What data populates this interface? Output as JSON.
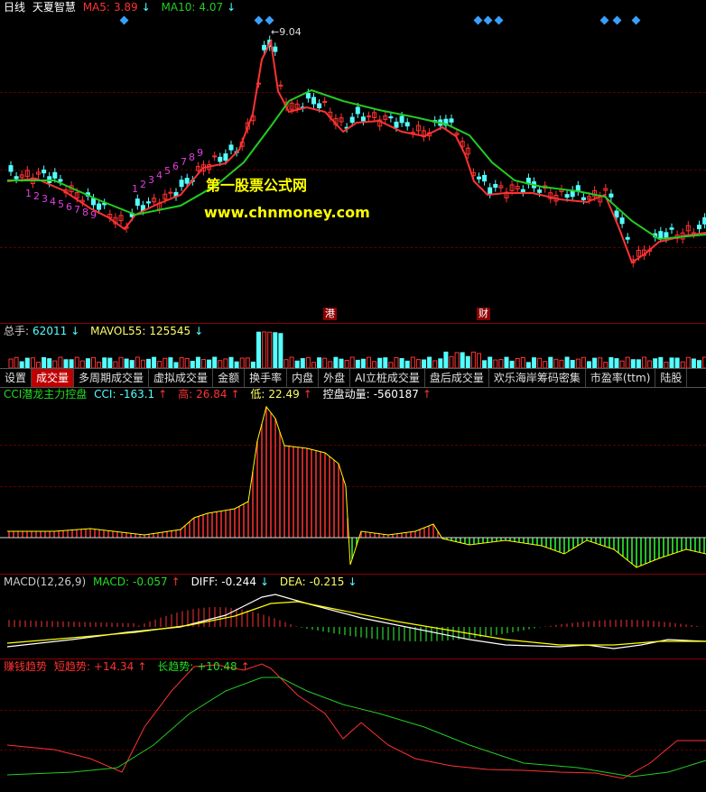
{
  "kline": {
    "period": "日线",
    "name": "天夏智慧",
    "ma5_label": "MA5:",
    "ma5_value": "3.89",
    "ma5_arrow": "↓",
    "ma10_label": "MA10:",
    "ma10_value": "4.07",
    "ma10_arrow": "↓",
    "peak_label": "9.04",
    "markers": [
      "港",
      "财"
    ],
    "watermark_cn": "第一股票公式网",
    "watermark_url": "www.chnmoney.com",
    "count_labels_a": [
      "1",
      "2",
      "3",
      "4",
      "5",
      "6",
      "7",
      "8",
      "9"
    ],
    "count_labels_b": [
      "1",
      "2",
      "3",
      "4",
      "5",
      "6",
      "7",
      "8",
      "9"
    ]
  },
  "volume": {
    "label": "总手:",
    "value": "62011",
    "arrow": "↓",
    "mavol_label": "MAVOL55:",
    "mavol_value": "125545",
    "mavol_arrow": "↓"
  },
  "tabs": [
    "设置",
    "成交量",
    "多周期成交量",
    "虚拟成交量",
    "金额",
    "换手率",
    "内盘",
    "外盘",
    "AI立桩成交量",
    "盘后成交量",
    "欢乐海岸筹码密集",
    "市盈率(ttm)",
    "陆股"
  ],
  "cci": {
    "title": "CCI潜龙主力控盘",
    "cci_label": "CCI:",
    "cci_value": "-163.1",
    "cci_arrow": "↑",
    "high_label": "高:",
    "high_value": "26.84",
    "high_arrow": "↑",
    "low_label": "低:",
    "low_value": "22.49",
    "low_arrow": "↑",
    "ctrl_label": "控盘动量:",
    "ctrl_value": "-560187",
    "ctrl_arrow": "↑"
  },
  "macd": {
    "title": "MACD(12,26,9)",
    "macd_label": "MACD:",
    "macd_value": "-0.057",
    "macd_arrow": "↑",
    "diff_label": "DIFF:",
    "diff_value": "-0.244",
    "diff_arrow": "↓",
    "dea_label": "DEA:",
    "dea_value": "-0.215",
    "dea_arrow": "↓"
  },
  "trend": {
    "title": "赚钱趋势",
    "short_label": "短趋势:",
    "short_value": "+14.34",
    "short_arrow": "↑",
    "long_label": "长趋势:",
    "long_value": "+10.48",
    "long_arrow": "↑"
  },
  "colors": {
    "up": "#ff3232",
    "down": "#54ffff",
    "ma5": "#ff3232",
    "ma10": "#22cc22",
    "green_bar": "#33ff33",
    "yellow": "#ffff00"
  }
}
